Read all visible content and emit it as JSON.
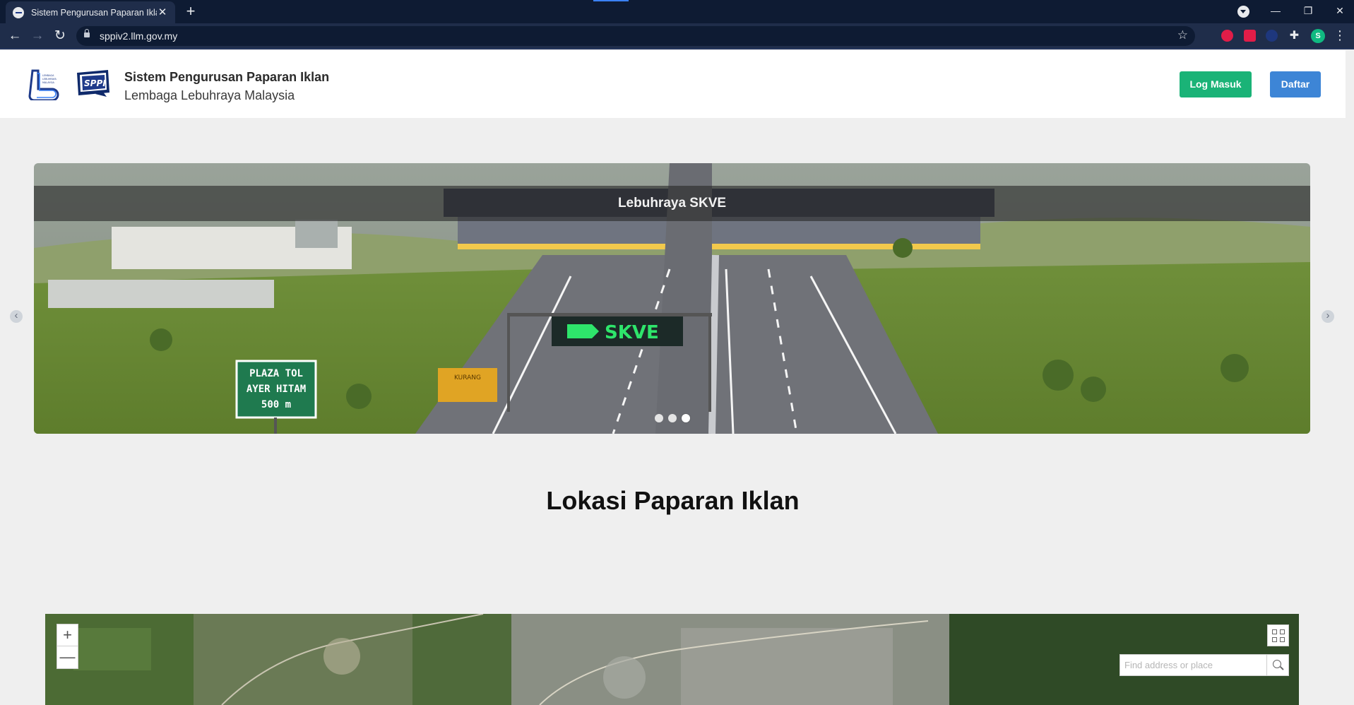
{
  "browser": {
    "tab_title": "Sistem Pengurusan Paparan Iklan",
    "tab_close": "✕",
    "new_tab": "+",
    "url": "sppiv2.llm.gov.my",
    "avatar_letter": "S",
    "window_controls": {
      "minimize": "—",
      "restore": "❐",
      "close": "✕"
    }
  },
  "header": {
    "logo_llm_lines": [
      "LEMBAGA",
      "LEBUHRAYA",
      "MALAYSIA"
    ],
    "logo_sppi_text": "SPPI",
    "title": "Sistem Pengurusan Paparan Iklan",
    "subtitle": "Lembaga Lebuhraya Malaysia",
    "login_label": "Log Masuk",
    "register_label": "Daftar"
  },
  "carousel": {
    "caption": "Lebuhraya SKVE",
    "sign_text": "SKVE",
    "toll_sign_lines": [
      "PLAZA TOL",
      "AYER HITAM",
      "500 m"
    ],
    "kurang_sign": "KURANG",
    "slides": 3,
    "active_index": 2,
    "prev_icon": "‹",
    "next_icon": "›"
  },
  "section": {
    "title": "Lokasi Paparan Iklan"
  },
  "map": {
    "zoom_in": "+",
    "zoom_out": "—",
    "search_placeholder": "Find address or place"
  },
  "colors": {
    "login": "#1ab377",
    "register": "#3d85d6",
    "chrome_dark": "#0e1b33",
    "chrome_bar": "#1f2d4a"
  }
}
